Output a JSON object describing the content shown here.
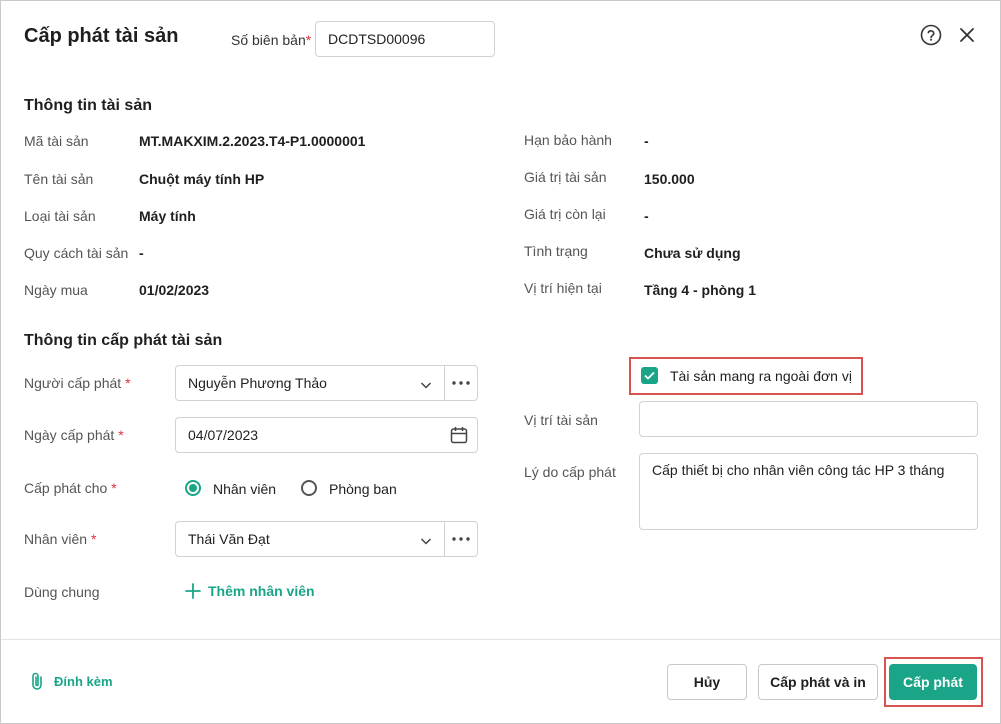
{
  "header": {
    "title": "Cấp phát tài sản",
    "record_label": "Số biên bản",
    "record_required": "*",
    "record_value": "DCDTSD00096"
  },
  "asset_info": {
    "section_title": "Thông tin tài sản",
    "left": [
      {
        "label": "Mã tài sản",
        "value": "MT.MAKXIM.2.2023.T4-P1.0000001"
      },
      {
        "label": "Tên tài sản",
        "value": "Chuột máy tính HP"
      },
      {
        "label": "Loại tài sản",
        "value": "Máy tính"
      },
      {
        "label": "Quy cách tài sản",
        "value": "-"
      },
      {
        "label": "Ngày mua",
        "value": "01/02/2023"
      }
    ],
    "right": [
      {
        "label": "Hạn bảo hành",
        "value": "-"
      },
      {
        "label": "Giá trị tài sản",
        "value": "150.000"
      },
      {
        "label": "Giá trị còn lại",
        "value": "-"
      },
      {
        "label": "Tình trạng",
        "value": "Chưa sử dụng"
      },
      {
        "label": "Vị trí hiện tại",
        "value": "Tầng 4 - phòng 1"
      }
    ]
  },
  "allocation": {
    "section_title": "Thông tin cấp phát tài sản",
    "issuer_label": "Người cấp phát",
    "issuer_value": "Nguyễn Phương Thảo",
    "date_label": "Ngày cấp phát",
    "date_value": "04/07/2023",
    "target_label": "Cấp phát cho",
    "target_options": [
      "Nhân viên",
      "Phòng ban"
    ],
    "employee_label": "Nhân viên",
    "employee_value": "Thái Văn Đạt",
    "shared_label": "Dùng chung",
    "add_employee_label": "Thêm nhân viên",
    "required_mark": "*",
    "take_out_label": "Tài sản mang ra ngoài đơn vị",
    "location_label": "Vị trí tài sản",
    "location_value": "",
    "reason_label": "Lý do cấp phát",
    "reason_value": "Cấp thiết bị cho nhân viên công tác HP 3 tháng"
  },
  "footer": {
    "attach_label": "Đính kèm",
    "cancel_label": "Hủy",
    "allocate_print_label": "Cấp phát và in",
    "allocate_label": "Cấp phát"
  },
  "colors": {
    "accent": "#1aa588",
    "highlight": "#d9534f"
  }
}
